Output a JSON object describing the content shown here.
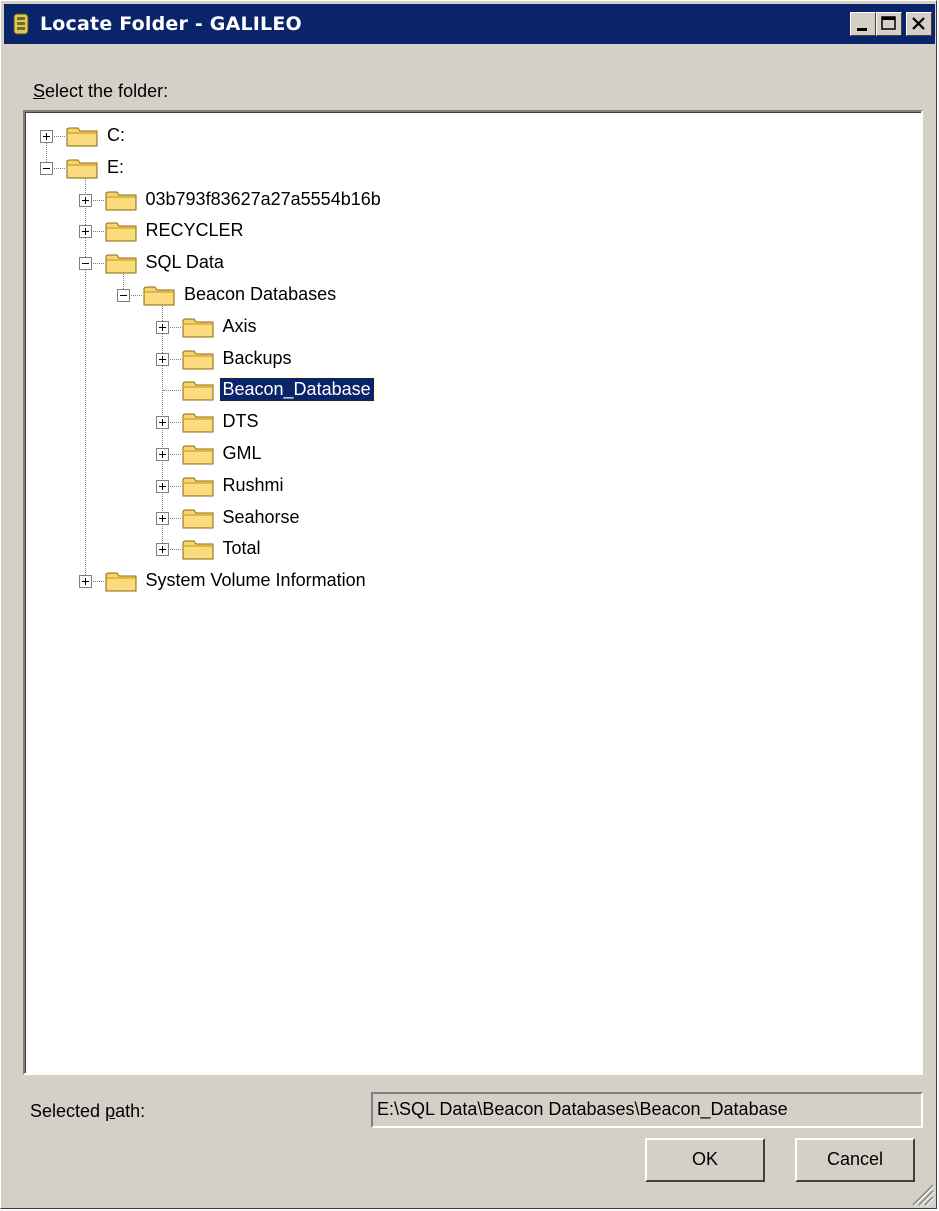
{
  "window": {
    "title": "Locate Folder - GALILEO",
    "title_icon": "app-icon"
  },
  "labels": {
    "select_folder_prefix": "S",
    "select_folder_rest": "elect the folder:",
    "selected_path_prefix": "Selected ",
    "selected_path_accel": "p",
    "selected_path_rest": "ath:"
  },
  "tree": {
    "nodes": [
      {
        "label": "C:",
        "level": 0,
        "expander": "plus"
      },
      {
        "label": "E:",
        "level": 0,
        "expander": "minus"
      },
      {
        "label": "03b793f83627a27a5554b16b",
        "level": 1,
        "expander": "plus"
      },
      {
        "label": "RECYCLER",
        "level": 1,
        "expander": "plus"
      },
      {
        "label": "SQL Data",
        "level": 1,
        "expander": "minus"
      },
      {
        "label": "Beacon Databases",
        "level": 2,
        "expander": "minus"
      },
      {
        "label": "Axis",
        "level": 3,
        "expander": "plus"
      },
      {
        "label": "Backups",
        "level": 3,
        "expander": "plus"
      },
      {
        "label": "Beacon_Database",
        "level": 3,
        "expander": "none",
        "selected": true
      },
      {
        "label": "DTS",
        "level": 3,
        "expander": "plus"
      },
      {
        "label": "GML",
        "level": 3,
        "expander": "plus"
      },
      {
        "label": "Rushmi",
        "level": 3,
        "expander": "plus"
      },
      {
        "label": "Seahorse",
        "level": 3,
        "expander": "plus"
      },
      {
        "label": "Total",
        "level": 3,
        "expander": "plus"
      },
      {
        "label": "System Volume Information",
        "level": 1,
        "expander": "plus"
      }
    ]
  },
  "selected_path": {
    "value": "E:\\SQL Data\\Beacon Databases\\Beacon_Database"
  },
  "buttons": {
    "ok": "OK",
    "cancel": "Cancel"
  },
  "colors": {
    "titlebar": "#0a246a",
    "window_face": "#d4d0c8",
    "selection": "#0a246a",
    "folder": "#f7d46a"
  }
}
